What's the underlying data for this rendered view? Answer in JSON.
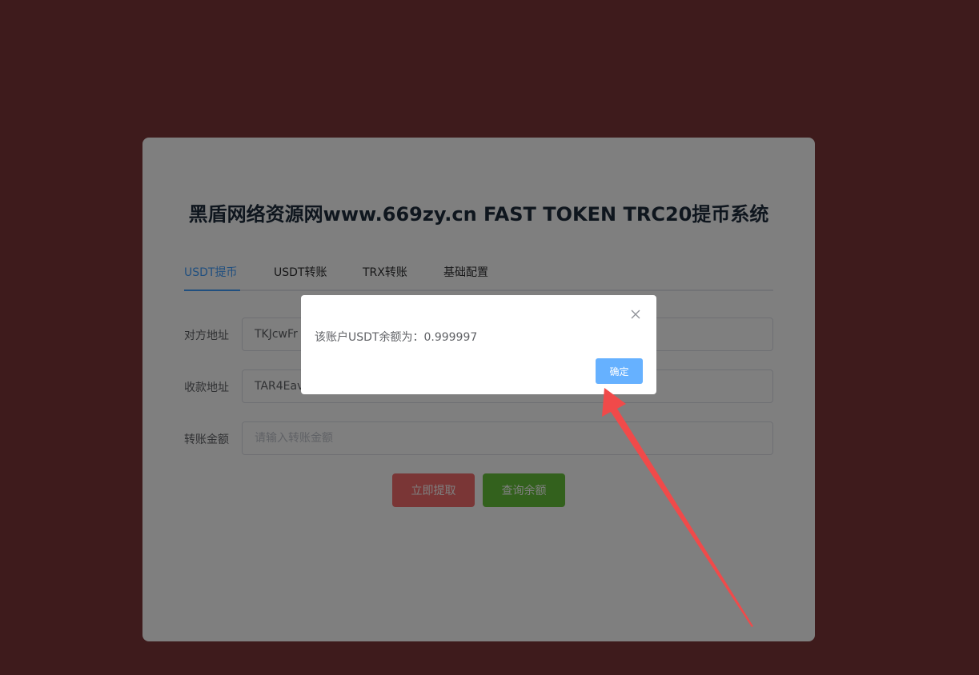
{
  "page": {
    "title": "黑盾网络资源网www.669zy.cn FAST TOKEN TRC20提币系统"
  },
  "tabs": [
    {
      "label": "USDT提币",
      "active": true
    },
    {
      "label": "USDT转账",
      "active": false
    },
    {
      "label": "TRX转账",
      "active": false
    },
    {
      "label": "基础配置",
      "active": false
    }
  ],
  "form": {
    "counterparty_address": {
      "label": "对方地址",
      "value": "TKJcwFr"
    },
    "receiving_address": {
      "label": "收款地址",
      "value": "TAR4Eav"
    },
    "transfer_amount": {
      "label": "转账金额",
      "value": "",
      "placeholder": "请输入转账金额"
    }
  },
  "buttons": {
    "withdraw": "立即提取",
    "query_balance": "查询余额"
  },
  "dialog": {
    "message": "该账户USDT余额为：0.999997",
    "confirm": "确定"
  },
  "colors": {
    "background": "#7d3738",
    "primary": "#409eff",
    "danger": "#f56c6c",
    "success": "#67c23a",
    "annotation_arrow": "#f04a4a"
  },
  "icons": {
    "close": "close-icon"
  }
}
